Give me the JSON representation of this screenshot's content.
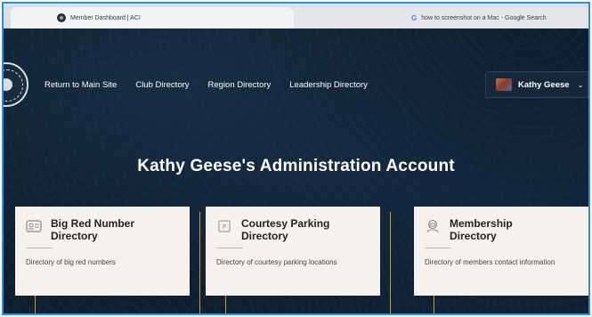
{
  "browser": {
    "active_tab_title": "Member Dashboard | ACI",
    "inactive_tab_title": "how to screenshot on a Mac - Google Search",
    "inactive_tab_icon": "google-g"
  },
  "nav": {
    "links": [
      {
        "label": "Return to Main Site"
      },
      {
        "label": "Club Directory"
      },
      {
        "label": "Region Directory"
      },
      {
        "label": "Leadership Directory"
      }
    ],
    "user": {
      "name": "Kathy Geese",
      "caret": "⌄"
    }
  },
  "page": {
    "title": "Kathy Geese's Administration Account"
  },
  "cards": [
    {
      "icon": "id-card-icon",
      "title_line1": "Big Red Number",
      "title_line2": "Directory",
      "description": "Directory of big red numbers"
    },
    {
      "icon": "parking-icon",
      "title_line1": "Courtesy Parking",
      "title_line2": "Directory",
      "description": "Directory of courtesy parking locations"
    },
    {
      "icon": "member-icon",
      "title_line1": "Membership",
      "title_line2": "Directory",
      "description": "Directory of members contact information"
    }
  ],
  "colors": {
    "accent_gold": "#c99a2e",
    "page_bg": "#0e1f31",
    "card_bg": "#f5f2ee",
    "screenshot_border": "#2d8fd6"
  }
}
